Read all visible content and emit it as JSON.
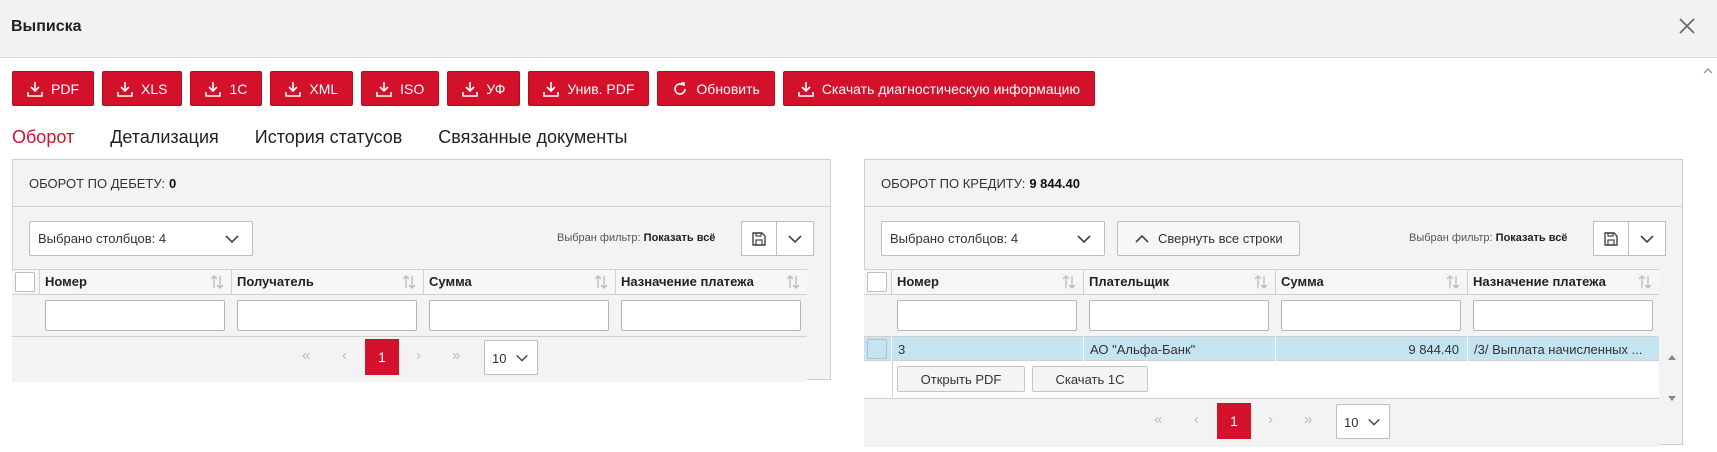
{
  "window": {
    "title": "Выписка"
  },
  "toolbar": {
    "buttons": [
      "PDF",
      "XLS",
      "1С",
      "XML",
      "ISO",
      "УФ",
      "Унив. PDF",
      "Обновить",
      "Скачать диагностическую информацию"
    ]
  },
  "tabs": [
    "Оборот",
    "Детализация",
    "История статусов",
    "Связанные документы"
  ],
  "debit": {
    "label": "ОБОРОТ ПО ДЕБЕТУ:",
    "value": "0",
    "columns_select": "Выбрано столбцов: 4",
    "filter_label": "Выбран фильтр:",
    "filter_value": "Показать всё",
    "headers": [
      "Номер",
      "Получатель",
      "Сумма",
      "Назначение платежа"
    ],
    "pager": {
      "first": "«",
      "prev": "‹",
      "current": "1",
      "next": "›",
      "last": "»",
      "page_size": "10"
    }
  },
  "credit": {
    "label": "ОБОРОТ ПО КРЕДИТУ:",
    "value": "9 844.40",
    "columns_select": "Выбрано столбцов: 4",
    "collapse_label": "Свернуть все строки",
    "filter_label": "Выбран фильтр:",
    "filter_value": "Показать всё",
    "headers": [
      "Номер",
      "Плательщик",
      "Сумма",
      "Назначение платежа"
    ],
    "row": {
      "number": "3",
      "payer": "АО \"Альфа-Банк\"",
      "amount": "9 844.40",
      "purpose": "/3/ Выплата начисленных ..."
    },
    "row_actions": [
      "Открыть PDF",
      "Скачать 1С"
    ],
    "pager": {
      "first": "«",
      "prev": "‹",
      "current": "1",
      "next": "›",
      "last": "»",
      "page_size": "10"
    }
  },
  "colors": {
    "accent": "#d3112b",
    "row_highlight": "#c5e4f2"
  }
}
